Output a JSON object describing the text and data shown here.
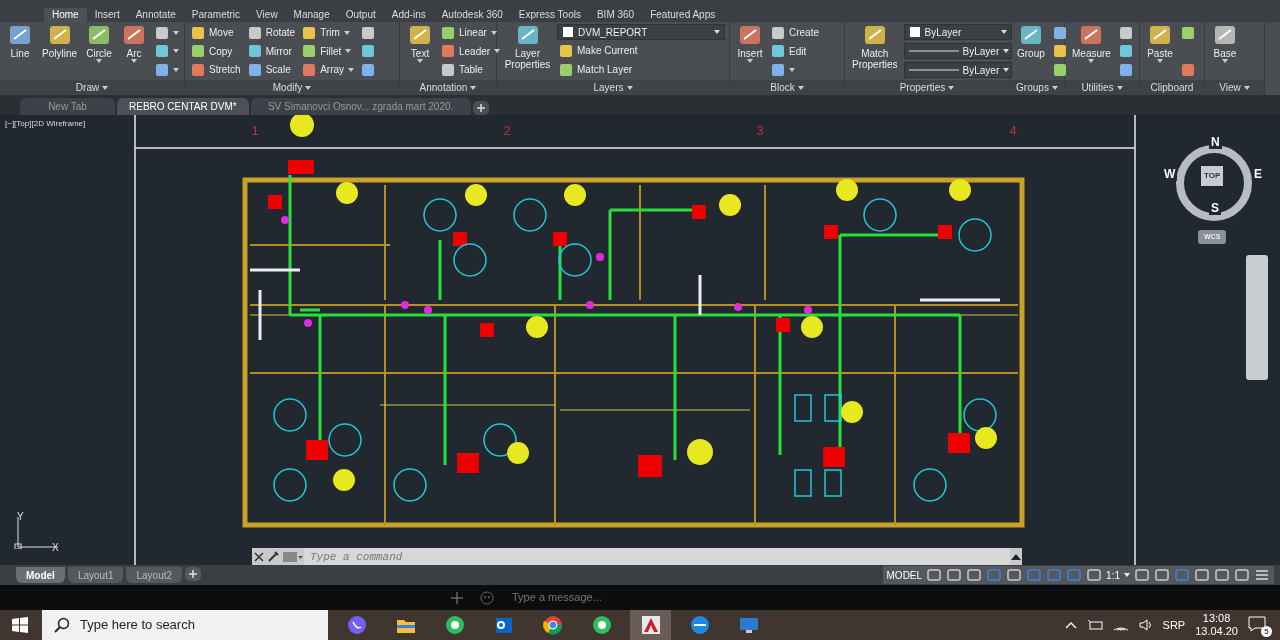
{
  "ribbon_tabs": [
    {
      "label": "Home",
      "selected": true
    },
    {
      "label": "Insert",
      "selected": false
    },
    {
      "label": "Annotate",
      "selected": false
    },
    {
      "label": "Parametric",
      "selected": false
    },
    {
      "label": "View",
      "selected": false
    },
    {
      "label": "Manage",
      "selected": false
    },
    {
      "label": "Output",
      "selected": false
    },
    {
      "label": "Add-ins",
      "selected": false
    },
    {
      "label": "Autodesk 360",
      "selected": false
    },
    {
      "label": "Express Tools",
      "selected": false
    },
    {
      "label": "BIM 360",
      "selected": false
    },
    {
      "label": "Featured Apps",
      "selected": false
    }
  ],
  "ribbon_panels": [
    {
      "title": "Draw",
      "menu": true,
      "tools": [
        {
          "kind": "large",
          "label": "Line"
        },
        {
          "kind": "large",
          "label": "Polyline"
        },
        {
          "kind": "large",
          "label": "Circle",
          "menu": true
        },
        {
          "kind": "large",
          "label": "Arc",
          "menu": true
        },
        {
          "kind": "icon",
          "menu": true
        },
        {
          "kind": "icon",
          "menu": true
        },
        {
          "kind": "icon",
          "menu": true
        }
      ]
    },
    {
      "title": "Modify",
      "menu": true,
      "tools": [
        {
          "kind": "small",
          "label": "Move"
        },
        {
          "kind": "small",
          "label": "Copy"
        },
        {
          "kind": "small",
          "label": "Stretch"
        },
        {
          "kind": "small",
          "label": "Rotate"
        },
        {
          "kind": "small",
          "label": "Mirror"
        },
        {
          "kind": "small",
          "label": "Scale"
        },
        {
          "kind": "small",
          "label": "Trim",
          "menu": true
        },
        {
          "kind": "small",
          "label": "Fillet",
          "menu": true
        },
        {
          "kind": "small",
          "label": "Array",
          "menu": true
        },
        {
          "kind": "icon"
        },
        {
          "kind": "icon"
        },
        {
          "kind": "icon"
        }
      ]
    },
    {
      "title": "Annotation",
      "menu": true,
      "tools": [
        {
          "kind": "large",
          "label": "Text",
          "menu": true
        },
        {
          "kind": "small",
          "label": "Linear",
          "menu": true
        },
        {
          "kind": "small",
          "label": "Leader",
          "menu": true
        },
        {
          "kind": "small",
          "label": "Table"
        }
      ]
    },
    {
      "title": "Layers",
      "menu": true,
      "tools": [
        {
          "kind": "large",
          "label": "Layer Properties"
        },
        {
          "kind": "dropdown",
          "value": "DVM_REPORT"
        },
        {
          "kind": "small",
          "label": "Make Current"
        },
        {
          "kind": "small",
          "label": "Match Layer"
        }
      ]
    },
    {
      "title": "Block",
      "menu": true,
      "tools": [
        {
          "kind": "large",
          "label": "Insert",
          "menu": true
        },
        {
          "kind": "small",
          "label": "Create"
        },
        {
          "kind": "small",
          "label": "Edit"
        },
        {
          "kind": "icon",
          "menu": true
        }
      ]
    },
    {
      "title": "Properties",
      "menu": true,
      "tools": [
        {
          "kind": "large",
          "label": "Match Properties"
        },
        {
          "kind": "dropdown",
          "value": "ByLayer"
        },
        {
          "kind": "line-dropdown",
          "value": "ByLayer"
        },
        {
          "kind": "line-dropdown",
          "value": "ByLayer"
        }
      ]
    },
    {
      "title": "Groups",
      "menu": true,
      "tools": [
        {
          "kind": "large",
          "label": "Group"
        },
        {
          "kind": "icon"
        },
        {
          "kind": "icon"
        },
        {
          "kind": "icon"
        }
      ]
    },
    {
      "title": "Utilities",
      "menu": true,
      "tools": [
        {
          "kind": "large",
          "label": "Measure",
          "menu": true
        },
        {
          "kind": "icon"
        },
        {
          "kind": "icon"
        },
        {
          "kind": "icon"
        }
      ]
    },
    {
      "title": "Clipboard",
      "menu": false,
      "tools": [
        {
          "kind": "large",
          "label": "Paste",
          "menu": true
        },
        {
          "kind": "icon"
        },
        {
          "kind": "icon"
        }
      ]
    },
    {
      "title": "View",
      "menu": true,
      "tools": [
        {
          "kind": "large",
          "label": "Base",
          "menu": true
        }
      ]
    }
  ],
  "file_tabs": [
    {
      "label": "New Tab",
      "selected": false
    },
    {
      "label": "REBRO CENTAR DVM*",
      "selected": true
    },
    {
      "label": "SV Simanovci Osnov... zgrada mart 2020.",
      "selected": false
    }
  ],
  "viewport_label": "[−][Top][2D Wireframe]",
  "drawing": {
    "grid_labels": [
      "1",
      "2",
      "3",
      "4"
    ]
  },
  "viewcube": {
    "north": "N",
    "south": "S",
    "east": "E",
    "west": "W",
    "face": "TOP",
    "ucs": "WCS"
  },
  "ucs_icon": {
    "y": "Y",
    "x": "X"
  },
  "command_line": {
    "placeholder": "Type a command"
  },
  "layout_tabs": [
    {
      "label": "Model",
      "selected": true
    },
    {
      "label": "Layout1",
      "selected": false
    },
    {
      "label": "Layout2",
      "selected": false
    }
  ],
  "status_bar": {
    "mode": "MODEL",
    "scale": "1:1"
  },
  "chat_window": {
    "placeholder": "Type a message..."
  },
  "taskbar": {
    "search_placeholder": "Type here to search",
    "apps": [
      {
        "kind": "chat",
        "selected": false
      },
      {
        "kind": "folder",
        "selected": false
      },
      {
        "kind": "note",
        "selected": false
      },
      {
        "kind": "mail",
        "selected": false
      },
      {
        "kind": "browser",
        "selected": false
      },
      {
        "kind": "note",
        "selected": false
      },
      {
        "kind": "cad",
        "selected": true
      },
      {
        "kind": "globe",
        "selected": false
      },
      {
        "kind": "monitor",
        "selected": false
      }
    ],
    "language": "SRP",
    "time": "13:08",
    "date": "13.04.20",
    "notifications": "5"
  }
}
